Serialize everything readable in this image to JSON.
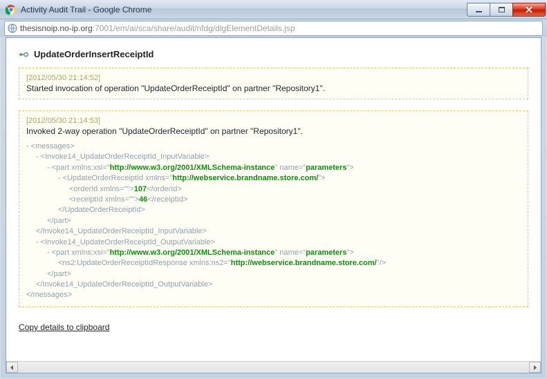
{
  "window": {
    "title": "Activity Audit Trail - Google Chrome"
  },
  "address": {
    "host": "thesisnoip.no-ip.org",
    "path": ":7001/em/ai/sca/share/audit/nfdg/dlgElementDetails.jsp"
  },
  "section_title": "UpdateOrderInsertReceiptId",
  "box1": {
    "timestamp": "[2012/05/30 21:14:52]",
    "message": "Started invocation of operation \"UpdateOrderReceiptId\" on partner \"Repository1\"."
  },
  "box2": {
    "timestamp": "[2012/05/30 21:14:53]",
    "message": "Invoked 2-way operation \"UpdateOrderReceiptId\" on partner \"Repository1\"."
  },
  "xml": {
    "messages_open": "<messages>",
    "inputvar_open": "<Invoke14_UpdateOrderReceiptId_InputVariable>",
    "part_open_prefix": "<part xmlns:xsi=\"",
    "xsi_url": "http://www.w3.org/2001/XMLSchema-instance",
    "part_mid": "\" name=\"",
    "param_name": "parameters",
    "part_open_suffix": "\">",
    "update_open_prefix": "<UpdateOrderReceiptId xmlns=\"",
    "ws_url": "http://webservice.brandname.store.com/",
    "tag_close": "\">",
    "orderid_open": "<orderId xmlns=\"\">",
    "orderid_val": "107",
    "orderid_close": "</orderId>",
    "receiptid_open": "<receiptId xmlns=\"\">",
    "receiptid_val": "46",
    "receiptid_close": "</receiptId>",
    "update_close": "</UpdateOrderReceiptId>",
    "part_close": "</part>",
    "inputvar_close": "</Invoke14_UpdateOrderReceiptId_InputVariable>",
    "outputvar_open": "<Invoke14_UpdateOrderReceiptId_OutputVariable>",
    "response_prefix": "<ns2:UpdateOrderReceiptIdResponse xmlns:ns2=\"",
    "response_suffix": "\"/>",
    "outputvar_close": "</Invoke14_UpdateOrderReceiptId_OutputVariable>",
    "messages_close": "</messages>"
  },
  "copy_label": "Copy details to clipboard"
}
